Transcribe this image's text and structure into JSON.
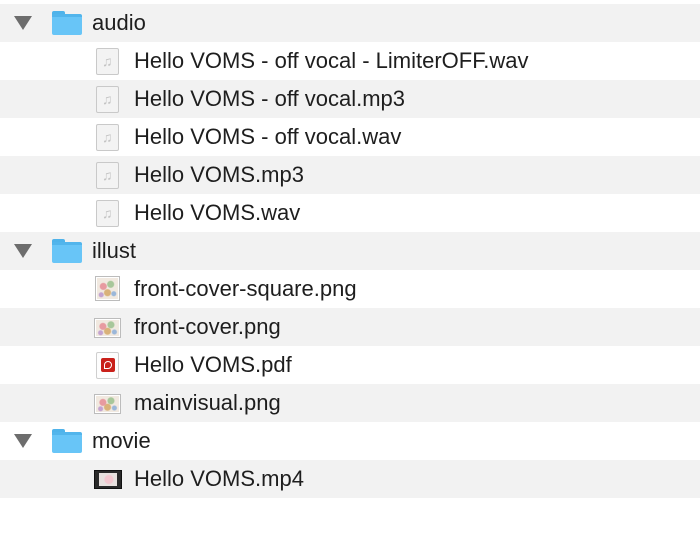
{
  "folders": [
    {
      "name": "audio",
      "expanded": true,
      "icon": "folder-icon",
      "files": [
        {
          "name": "Hello VOMS - off vocal - LimiterOFF.wav",
          "icon": "audio-file-icon"
        },
        {
          "name": "Hello VOMS - off vocal.mp3",
          "icon": "audio-file-icon"
        },
        {
          "name": "Hello VOMS - off vocal.wav",
          "icon": "audio-file-icon"
        },
        {
          "name": "Hello VOMS.mp3",
          "icon": "audio-file-icon"
        },
        {
          "name": "Hello VOMS.wav",
          "icon": "audio-file-icon"
        }
      ]
    },
    {
      "name": "illust",
      "expanded": true,
      "icon": "folder-icon",
      "files": [
        {
          "name": "front-cover-square.png",
          "icon": "image-thumbnail-icon"
        },
        {
          "name": "front-cover.png",
          "icon": "image-thumbnail-icon"
        },
        {
          "name": "Hello VOMS.pdf",
          "icon": "pdf-file-icon"
        },
        {
          "name": "mainvisual.png",
          "icon": "image-thumbnail-icon"
        }
      ]
    },
    {
      "name": "movie",
      "expanded": true,
      "icon": "folder-icon",
      "files": [
        {
          "name": "Hello VOMS.mp4",
          "icon": "movie-thumbnail-icon"
        }
      ]
    }
  ],
  "colors": {
    "row_alt": "#f2f2f2",
    "folder": "#68c5f7",
    "disclosure": "#6d6d6d",
    "text": "#1e1e1e"
  }
}
